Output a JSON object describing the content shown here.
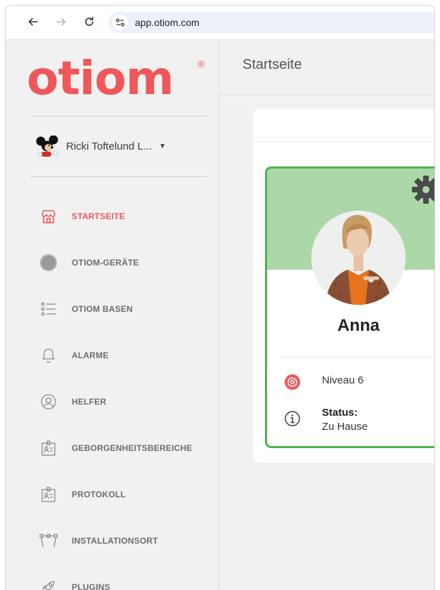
{
  "browser": {
    "url": "app.otiom.com"
  },
  "sidebar": {
    "logo": "otiom",
    "logo_mark": "®",
    "user_name": "Ricki Toftelund L...",
    "items": [
      {
        "label": "STARTSEITE",
        "icon": "home-store-icon",
        "active": true
      },
      {
        "label": "OTIOM-GERÄTE",
        "icon": "device-circle-icon",
        "active": false
      },
      {
        "label": "OTIOM BASEN",
        "icon": "list-icon",
        "active": false
      },
      {
        "label": "ALARME",
        "icon": "bell-icon",
        "active": false
      },
      {
        "label": "HELFER",
        "icon": "user-circle-icon",
        "active": false
      },
      {
        "label": "GEBORGENHEITSBEREICHE",
        "icon": "id-badge-icon",
        "active": false
      },
      {
        "label": "PROTOKOLL",
        "icon": "id-badge-icon",
        "active": false
      },
      {
        "label": "INSTALLATIONSORT",
        "icon": "route-icon",
        "active": false
      },
      {
        "label": "PLUGINS",
        "icon": "rocket-icon",
        "active": false
      }
    ]
  },
  "main": {
    "page_title": "Startseite",
    "card": {
      "name": "Anna",
      "level": "Niveau 6",
      "status_label": "Status:",
      "status_value": "Zu Hause"
    }
  },
  "colors": {
    "brand": "#f0575a",
    "card_border": "#4fb24f",
    "card_header": "#acd7a8"
  }
}
